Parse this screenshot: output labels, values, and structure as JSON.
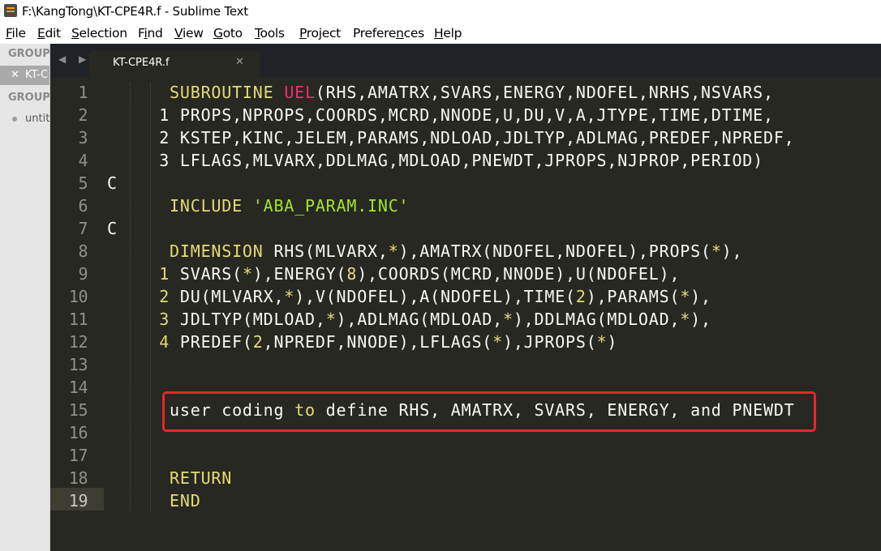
{
  "window": {
    "title": "F:\\KangTong\\KT-CPE4R.f - Sublime Text",
    "icon": "sublime-text-icon"
  },
  "menu": [
    {
      "pre": "",
      "ul": "F",
      "post": "ile"
    },
    {
      "pre": "",
      "ul": "E",
      "post": "dit"
    },
    {
      "pre": "",
      "ul": "S",
      "post": "election"
    },
    {
      "pre": "F",
      "ul": "i",
      "post": "nd"
    },
    {
      "pre": "",
      "ul": "V",
      "post": "iew"
    },
    {
      "pre": "",
      "ul": "G",
      "post": "oto"
    },
    {
      "pre": "",
      "ul": "T",
      "post": "ools"
    },
    {
      "pre": "",
      "ul": "P",
      "post": "roject"
    },
    {
      "pre": "Prefere",
      "ul": "n",
      "post": "ces"
    },
    {
      "pre": "",
      "ul": "H",
      "post": "elp"
    }
  ],
  "sidebar": {
    "group1": "GROUP",
    "group2": "GROUP",
    "active_file": "KT-C",
    "close_glyph": "✕",
    "untitled": "untitl"
  },
  "tabbar": {
    "nav": "◀ ▶",
    "tab_label": "KT-CPE4R.f",
    "tab_close": "✕"
  },
  "editor": {
    "cursor_line": 19,
    "highlighted_line": 15,
    "highlight_color": "#e8262a",
    "lines": [
      {
        "n": "1",
        "segs": [
          {
            "t": "      SUBROUTINE ",
            "c": "lit"
          },
          {
            "t": "UEL",
            "c": "red"
          },
          {
            "t": "(RHS,AMATRX,SVARS,ENERGY,NDOFEL,NRHS,NSVARS,",
            "c": ""
          }
        ]
      },
      {
        "n": "2",
        "segs": [
          {
            "t": "     1 PROPS,NPROPS,COORDS,MCRD,NNODE,U,DU,V,A,JTYPE,TIME,DTIME,",
            "c": ""
          }
        ]
      },
      {
        "n": "3",
        "segs": [
          {
            "t": "     2 KSTEP,KINC,JELEM,PARAMS,NDLOAD,JDLTYP,ADLMAG,PREDEF,NPREDF,",
            "c": ""
          }
        ]
      },
      {
        "n": "4",
        "segs": [
          {
            "t": "     3 LFLAGS,MLVARX,DDLMAG,MDLOAD,PNEWDT,JPROPS,NJPROP,PERIOD)",
            "c": ""
          }
        ]
      },
      {
        "n": "5",
        "segs": [
          {
            "t": "C",
            "c": ""
          }
        ]
      },
      {
        "n": "6",
        "segs": [
          {
            "t": "      INCLUDE ",
            "c": "lit"
          },
          {
            "t": "'ABA_PARAM.INC'",
            "c": "str"
          }
        ]
      },
      {
        "n": "7",
        "segs": [
          {
            "t": "C",
            "c": ""
          }
        ]
      },
      {
        "n": "8",
        "segs": [
          {
            "t": "      DIMENSION ",
            "c": "lit"
          },
          {
            "t": "RHS(MLVARX,",
            "c": ""
          },
          {
            "t": "*",
            "c": "lit"
          },
          {
            "t": "),AMATRX(NDOFEL,NDOFEL),PROPS(",
            "c": ""
          },
          {
            "t": "*",
            "c": "lit"
          },
          {
            "t": "),",
            "c": ""
          }
        ]
      },
      {
        "n": "9",
        "segs": [
          {
            "t": "     ",
            "c": ""
          },
          {
            "t": "1",
            "c": "lit"
          },
          {
            "t": " SVARS(",
            "c": ""
          },
          {
            "t": "*",
            "c": "lit"
          },
          {
            "t": "),ENERGY(",
            "c": ""
          },
          {
            "t": "8",
            "c": "lit"
          },
          {
            "t": "),COORDS(MCRD,NNODE),U(NDOFEL),",
            "c": ""
          }
        ]
      },
      {
        "n": "10",
        "segs": [
          {
            "t": "     ",
            "c": ""
          },
          {
            "t": "2",
            "c": "lit"
          },
          {
            "t": " DU(MLVARX,",
            "c": ""
          },
          {
            "t": "*",
            "c": "lit"
          },
          {
            "t": "),V(NDOFEL),A(NDOFEL),TIME(",
            "c": ""
          },
          {
            "t": "2",
            "c": "lit"
          },
          {
            "t": "),PARAMS(",
            "c": ""
          },
          {
            "t": "*",
            "c": "lit"
          },
          {
            "t": "),",
            "c": ""
          }
        ]
      },
      {
        "n": "11",
        "segs": [
          {
            "t": "     ",
            "c": ""
          },
          {
            "t": "3",
            "c": "lit"
          },
          {
            "t": " JDLTYP(MDLOAD,",
            "c": ""
          },
          {
            "t": "*",
            "c": "lit"
          },
          {
            "t": "),ADLMAG(MDLOAD,",
            "c": ""
          },
          {
            "t": "*",
            "c": "lit"
          },
          {
            "t": "),DDLMAG(MDLOAD,",
            "c": ""
          },
          {
            "t": "*",
            "c": "lit"
          },
          {
            "t": "),",
            "c": ""
          }
        ]
      },
      {
        "n": "12",
        "segs": [
          {
            "t": "     ",
            "c": ""
          },
          {
            "t": "4",
            "c": "lit"
          },
          {
            "t": " PREDEF(",
            "c": ""
          },
          {
            "t": "2",
            "c": "lit"
          },
          {
            "t": ",NPREDF,NNODE),LFLAGS(",
            "c": ""
          },
          {
            "t": "*",
            "c": "lit"
          },
          {
            "t": "),JPROPS(",
            "c": ""
          },
          {
            "t": "*",
            "c": "lit"
          },
          {
            "t": ")",
            "c": ""
          }
        ]
      },
      {
        "n": "13",
        "segs": []
      },
      {
        "n": "14",
        "segs": []
      },
      {
        "n": "15",
        "segs": [
          {
            "t": "      user coding ",
            "c": ""
          },
          {
            "t": "to",
            "c": "lit"
          },
          {
            "t": " define RHS, AMATRX, SVARS, ENERGY, and PNEWDT",
            "c": ""
          }
        ]
      },
      {
        "n": "16",
        "segs": []
      },
      {
        "n": "17",
        "segs": []
      },
      {
        "n": "18",
        "segs": [
          {
            "t": "      RETURN",
            "c": "lit"
          }
        ]
      },
      {
        "n": "19",
        "segs": [
          {
            "t": "      END",
            "c": "lit"
          }
        ]
      }
    ]
  }
}
